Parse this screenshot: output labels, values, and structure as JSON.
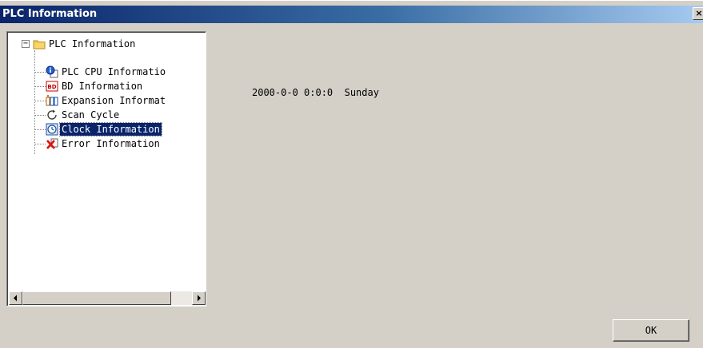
{
  "window": {
    "title": "PLC Information",
    "close_label": "×"
  },
  "tree": {
    "expander": "−",
    "root": {
      "label": "PLC Information",
      "icon": "folder-icon"
    },
    "items": [
      {
        "label": "PLC CPU Informatio",
        "icon": "cpu-info-icon",
        "selected": false
      },
      {
        "label": "BD Information",
        "icon": "bd-board-icon",
        "selected": false
      },
      {
        "label": "Expansion Informat",
        "icon": "expansion-module-icon",
        "selected": false
      },
      {
        "label": "Scan Cycle",
        "icon": "scan-cycle-icon",
        "selected": false
      },
      {
        "label": "Clock Information",
        "icon": "clock-icon",
        "selected": true
      },
      {
        "label": "Error Information",
        "icon": "error-icon",
        "selected": false
      }
    ]
  },
  "clock": {
    "value": "2000-0-0 0:0:0  Sunday"
  },
  "buttons": {
    "ok_label": "OK"
  },
  "colors": {
    "titlebar_start": "#0a246a",
    "titlebar_end": "#a6caf0",
    "dialog_bg": "#d4d0c8",
    "selection_bg": "#0a246a"
  }
}
